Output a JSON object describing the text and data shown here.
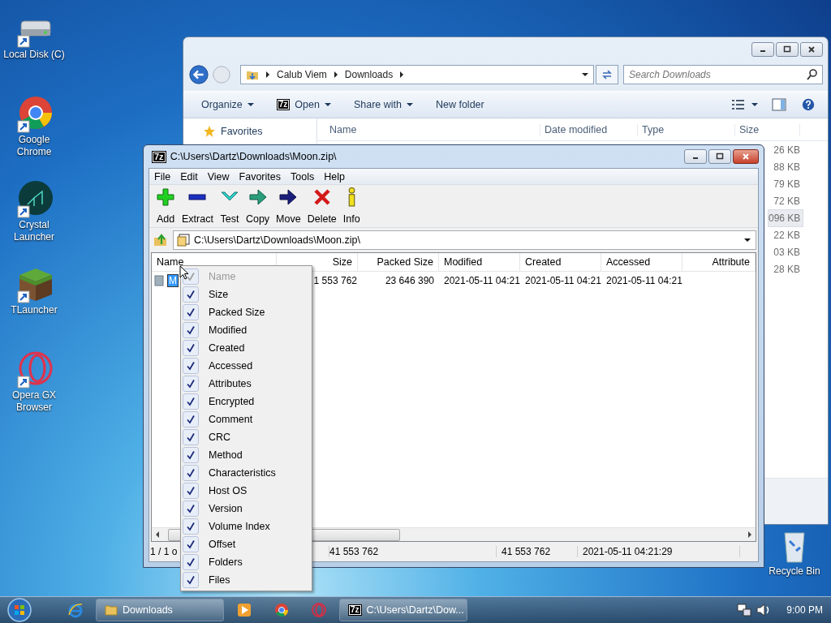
{
  "desktop": {
    "icons": [
      {
        "label": "Local Disk (C)",
        "kind": "drive"
      },
      {
        "label": "Google Chrome",
        "kind": "chrome"
      },
      {
        "label": "Crystal Launcher",
        "kind": "crystal"
      },
      {
        "label": "TLauncher",
        "kind": "block"
      },
      {
        "label": "Opera GX Browser",
        "kind": "opera"
      }
    ],
    "recycle_bin": {
      "label": "Recycle Bin"
    }
  },
  "explorer": {
    "breadcrumb": [
      "Calub Viem",
      "Downloads"
    ],
    "search": {
      "placeholder": "Search Downloads"
    },
    "toolbar": [
      {
        "label": "Organize",
        "kind": "menu"
      },
      {
        "label": "Open",
        "kind": "app",
        "icon_text": "7z"
      },
      {
        "label": "Share with",
        "kind": "menu"
      },
      {
        "label": "New folder",
        "kind": "plain"
      }
    ],
    "sidebar": [
      {
        "label": "Favorites",
        "kind": "favorites"
      }
    ],
    "columns": [
      "Name",
      "Date modified",
      "Type",
      "Size"
    ],
    "rows": [
      {
        "size": "26 KB",
        "selected": false
      },
      {
        "size": "88 KB",
        "selected": false
      },
      {
        "size": "79 KB",
        "selected": false
      },
      {
        "size": "72 KB",
        "selected": false
      },
      {
        "size": "096 KB",
        "selected": true
      },
      {
        "size": "22 KB",
        "selected": false
      },
      {
        "size": "03 KB",
        "selected": false
      },
      {
        "size": "28 KB",
        "selected": false
      }
    ]
  },
  "archiver": {
    "icon_text": "7z",
    "title": "C:\\Users\\Dartz\\Downloads\\Moon.zip\\",
    "menu": [
      "File",
      "Edit",
      "View",
      "Favorites",
      "Tools",
      "Help"
    ],
    "toolbar": [
      {
        "label": "Add",
        "kind": "add"
      },
      {
        "label": "Extract",
        "kind": "extract"
      },
      {
        "label": "Test",
        "kind": "test"
      },
      {
        "label": "Copy",
        "kind": "copy"
      },
      {
        "label": "Move",
        "kind": "move"
      },
      {
        "label": "Delete",
        "kind": "delete"
      },
      {
        "label": "Info",
        "kind": "info"
      }
    ],
    "path": "C:\\Users\\Dartz\\Downloads\\Moon.zip\\",
    "columns": [
      "Name",
      "Size",
      "Packed Size",
      "Modified",
      "Created",
      "Accessed",
      "Attribute"
    ],
    "rows": [
      {
        "editing": true,
        "cells": [
          "M",
          "1 553 762",
          "23 646 390",
          "2021-05-11 04:21",
          "2021-05-11 04:21",
          "2021-05-11 04:21"
        ]
      }
    ],
    "status": [
      "1 / 1 o",
      "41 553 762",
      "41 553 762",
      "2021-05-11 04:21:29"
    ]
  },
  "context_menu": [
    {
      "label": "Name",
      "checked": true,
      "disabled": true
    },
    {
      "label": "Size",
      "checked": true,
      "disabled": false
    },
    {
      "label": "Packed Size",
      "checked": true,
      "disabled": false
    },
    {
      "label": "Modified",
      "checked": true,
      "disabled": false
    },
    {
      "label": "Created",
      "checked": true,
      "disabled": false
    },
    {
      "label": "Accessed",
      "checked": true,
      "disabled": false
    },
    {
      "label": "Attributes",
      "checked": true,
      "disabled": false
    },
    {
      "label": "Encrypted",
      "checked": true,
      "disabled": false
    },
    {
      "label": "Comment",
      "checked": true,
      "disabled": false
    },
    {
      "label": "CRC",
      "checked": true,
      "disabled": false
    },
    {
      "label": "Method",
      "checked": true,
      "disabled": false
    },
    {
      "label": "Characteristics",
      "checked": true,
      "disabled": false
    },
    {
      "label": "Host OS",
      "checked": true,
      "disabled": false
    },
    {
      "label": "Version",
      "checked": true,
      "disabled": false
    },
    {
      "label": "Volume Index",
      "checked": true,
      "disabled": false
    },
    {
      "label": "Offset",
      "checked": true,
      "disabled": false
    },
    {
      "label": "Folders",
      "checked": true,
      "disabled": false
    },
    {
      "label": "Files",
      "checked": true,
      "disabled": false
    }
  ],
  "taskbar": {
    "items": [
      {
        "kind": "ie"
      },
      {
        "kind": "folder",
        "label": "Downloads"
      },
      {
        "kind": "media"
      },
      {
        "kind": "chrome"
      },
      {
        "kind": "opera"
      },
      {
        "kind": "app",
        "label": "C:\\Users\\Dartz\\Dow...",
        "icon_text": "7z"
      }
    ],
    "clock": "9:00 PM"
  }
}
